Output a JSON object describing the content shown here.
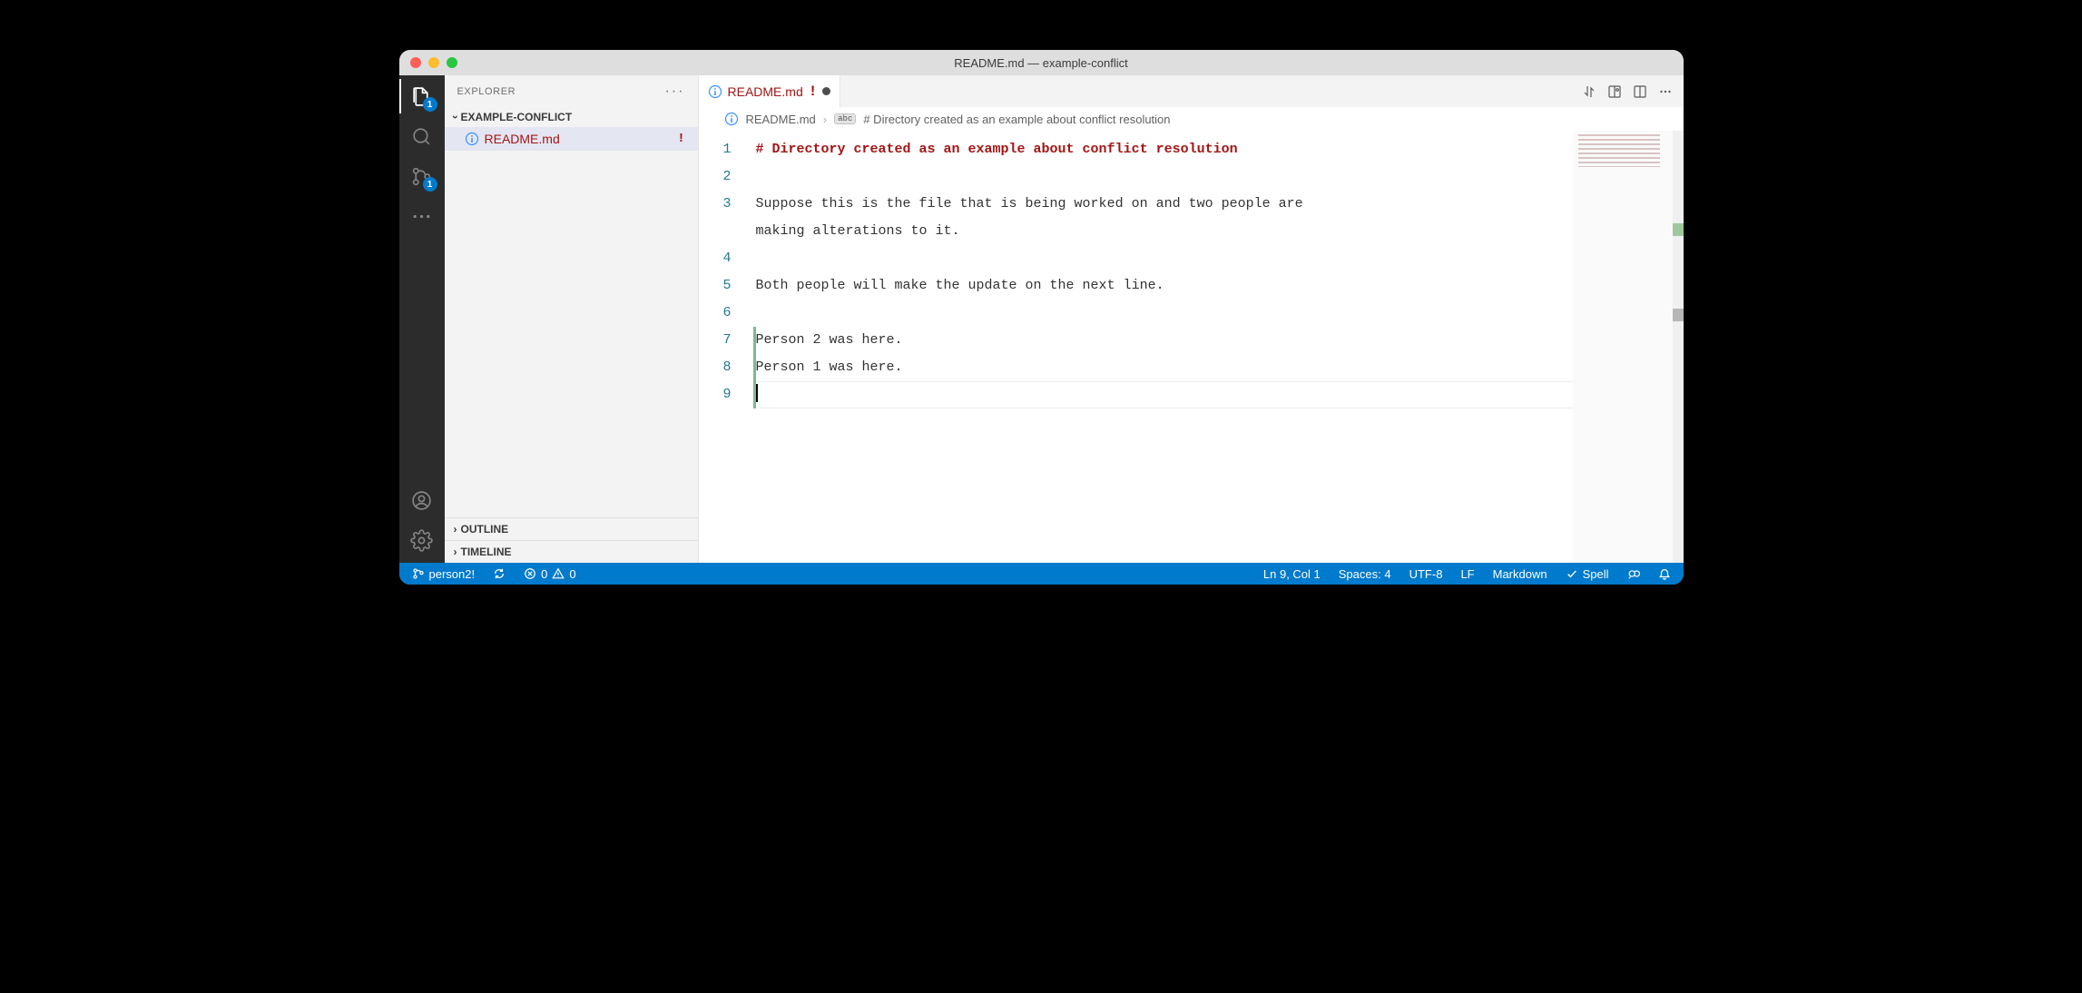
{
  "window": {
    "title": "README.md — example-conflict"
  },
  "activitybar": {
    "explorer_badge": "1",
    "scm_badge": "1"
  },
  "sidebar": {
    "title": "EXPLORER",
    "folder": "EXAMPLE-CONFLICT",
    "files": [
      {
        "name": "README.md",
        "warn": "!"
      }
    ],
    "outline": "OUTLINE",
    "timeline": "TIMELINE"
  },
  "tab": {
    "name": "README.md",
    "mark": "!"
  },
  "breadcrumb": {
    "file": "README.md",
    "symbol": "# Directory created as an example about conflict resolution"
  },
  "editor": {
    "lines": [
      {
        "n": 1,
        "added": false,
        "cls": "heading",
        "text": "# Directory created as an example about conflict resolution"
      },
      {
        "n": 2,
        "added": false,
        "cls": "",
        "text": ""
      },
      {
        "n": 3,
        "added": false,
        "cls": "",
        "text": "Suppose this is the file that is being worked on and two people are"
      },
      {
        "n": "",
        "added": false,
        "cls": "",
        "text": "making alterations to it."
      },
      {
        "n": 4,
        "added": false,
        "cls": "",
        "text": ""
      },
      {
        "n": 5,
        "added": false,
        "cls": "",
        "text": "Both people will make the update on the next line."
      },
      {
        "n": 6,
        "added": false,
        "cls": "",
        "text": ""
      },
      {
        "n": 7,
        "added": true,
        "cls": "",
        "text": "Person 2 was here."
      },
      {
        "n": 8,
        "added": true,
        "cls": "",
        "text": "Person 1 was here."
      },
      {
        "n": 9,
        "added": true,
        "cls": "cursor",
        "text": ""
      }
    ]
  },
  "status": {
    "branch": "person2!",
    "errors": "0",
    "warnings": "0",
    "cursor": "Ln 9, Col 1",
    "indent": "Spaces: 4",
    "encoding": "UTF-8",
    "eol": "LF",
    "language": "Markdown",
    "spell": "Spell"
  }
}
